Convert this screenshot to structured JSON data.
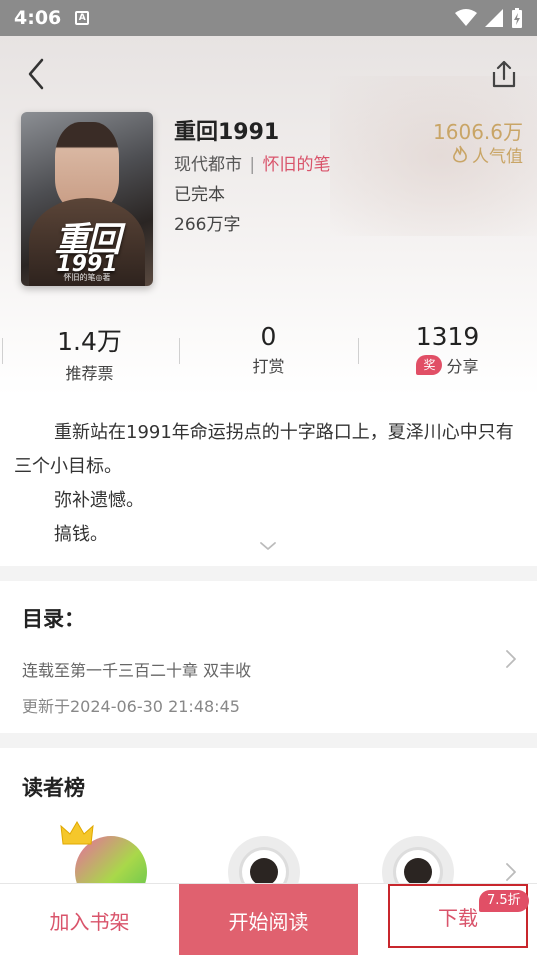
{
  "status_bar": {
    "time": "4:06"
  },
  "book": {
    "title": "重回1991",
    "category": "现代都市",
    "separator": "|",
    "author": "怀旧的笔",
    "status": "已完本",
    "word_count": "266万字",
    "popularity_value": "1606.6万",
    "popularity_label": "人气值",
    "cover": {
      "title_chars": "重回",
      "year": "1991",
      "author_line": "怀旧的笔◎著"
    }
  },
  "stats": [
    {
      "value": "1.4万",
      "label": "推荐票"
    },
    {
      "value": "0",
      "label": "打赏"
    },
    {
      "value": "1319",
      "label": "分享",
      "badge": "奖"
    }
  ],
  "intro": {
    "lines": [
      "重新站在1991年命运拐点的十字路口上，夏泽川心中只有三个小目标。",
      "弥补遗憾。",
      "搞钱。"
    ]
  },
  "catalog": {
    "heading": "目录：",
    "latest_chapter": "连载至第一千三百二十章 双丰收",
    "updated": "更新于2024-06-30 21:48:45"
  },
  "readers": {
    "heading": "读者榜"
  },
  "bottom_bar": {
    "add_shelf": "加入书架",
    "start_reading": "开始阅读",
    "download": "下载",
    "discount": "7.5折"
  }
}
